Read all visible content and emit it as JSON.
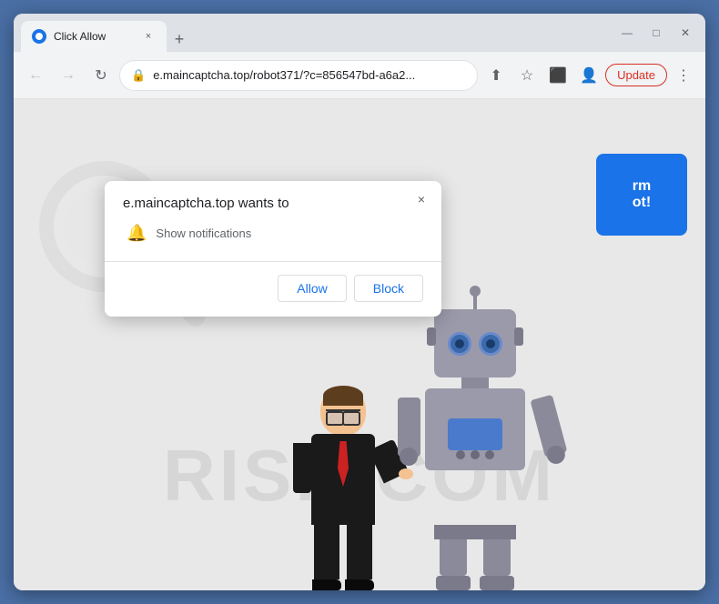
{
  "browser": {
    "title": "Click Allow",
    "tab_close_label": "×",
    "new_tab_label": "+",
    "window_controls": {
      "minimize": "—",
      "maximize": "□",
      "close": "✕"
    },
    "address": "e.maincaptcha.top/robot371/?c=856547bd-a6a2...",
    "update_btn_label": "Update",
    "nav": {
      "back": "←",
      "forward": "→",
      "reload": "↻"
    }
  },
  "popup": {
    "title": "e.maincaptcha.top wants to",
    "permission": "Show notifications",
    "close": "×",
    "allow_label": "Allow",
    "block_label": "Block"
  },
  "cta": {
    "line1": "rm",
    "line2": "ot!"
  },
  "watermark": "RISK.COM"
}
